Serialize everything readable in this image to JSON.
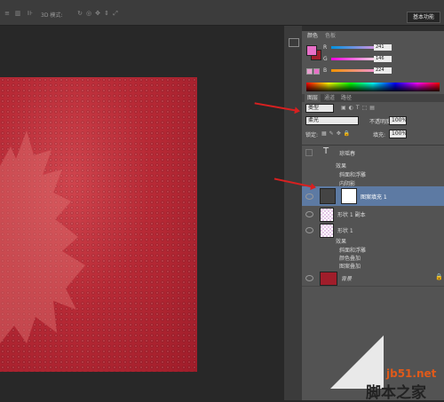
{
  "options_bar": {
    "mode_label": "3D 模式:",
    "workspace_button": "基本功能"
  },
  "color_panel": {
    "tabs": [
      "颜色",
      "色板"
    ],
    "foreground": "#e870c8",
    "background": "#a01d2a",
    "r": {
      "label": "R",
      "value": "241"
    },
    "g": {
      "label": "G",
      "value": "146"
    },
    "b": {
      "label": "B",
      "value": "224"
    }
  },
  "layers_panel": {
    "tabs": [
      "图层",
      "通道",
      "路径"
    ],
    "filter_kind": "类型",
    "blend_mode": "柔光",
    "opacity_label": "不透明度:",
    "opacity_value": "100%",
    "lock_label": "锁定:",
    "fill_label": "填充:",
    "fill_value": "100%",
    "layers": [
      {
        "name": "琼瑶春",
        "type": "text",
        "effects_label": "效果",
        "effects": [
          "斜面和浮雕",
          "内阴影"
        ]
      },
      {
        "name": "图案填充 1",
        "type": "fill",
        "selected": true
      },
      {
        "name": "形状 1 副本",
        "type": "shape"
      },
      {
        "name": "形状 1",
        "type": "shape",
        "effects_label": "效果",
        "effects": [
          "斜面和浮雕",
          "颜色叠加",
          "图案叠加"
        ]
      },
      {
        "name": "背景",
        "type": "background"
      }
    ]
  },
  "watermark": {
    "url": "jb51.net",
    "text": "脚本之家"
  },
  "colors": {
    "canvas_red": "#b82a36",
    "panel_gray": "#535353",
    "selected_layer": "#5d7aa3",
    "arrow_red": "#d82020"
  }
}
